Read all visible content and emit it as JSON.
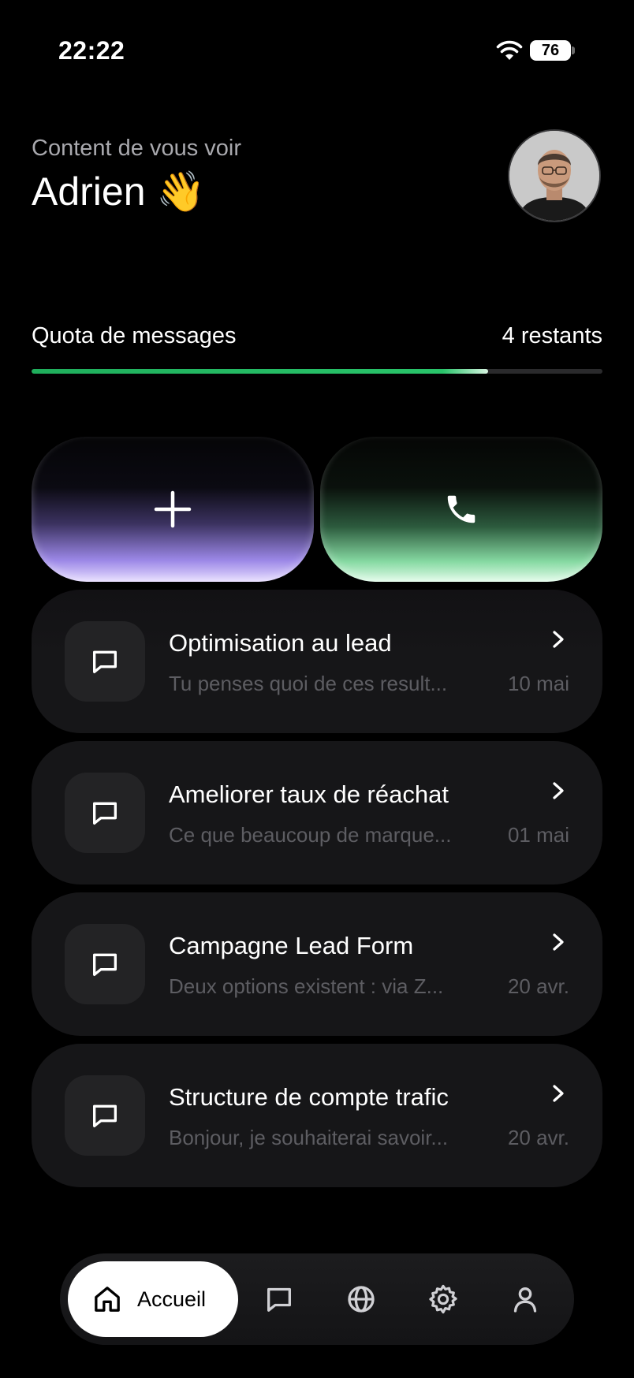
{
  "status_bar": {
    "time": "22:22",
    "battery": "76",
    "icons": [
      "wifi-icon",
      "battery-icon"
    ]
  },
  "header": {
    "greeting": "Content de vous voir",
    "name": "Adrien 👋",
    "avatar_icon": "user-photo"
  },
  "quota": {
    "label": "Quota de messages",
    "remaining": "4 restants",
    "progress_fraction": 0.8,
    "color": "#29c46a"
  },
  "actions": {
    "new_chat_icon": "plus-icon",
    "call_icon": "phone-icon",
    "new_chat_color": "#9b87e6",
    "call_color": "#86d9a2"
  },
  "conversations": [
    {
      "title": "Optimisation au lead",
      "preview": "Tu penses quoi de ces result...",
      "date": "10 mai"
    },
    {
      "title": "Ameliorer taux de réachat",
      "preview": "Ce que beaucoup de marque...",
      "date": "01 mai"
    },
    {
      "title": "Campagne Lead Form",
      "preview": "Deux options existent : via Z...",
      "date": "20 avr."
    },
    {
      "title": "Structure de compte trafic",
      "preview": "Bonjour, je souhaiterai savoir...",
      "date": "20 avr."
    }
  ],
  "nav": {
    "home_label": "Accueil",
    "items": [
      "home-icon",
      "chat-icon",
      "globe-icon",
      "gear-icon",
      "user-icon"
    ]
  }
}
